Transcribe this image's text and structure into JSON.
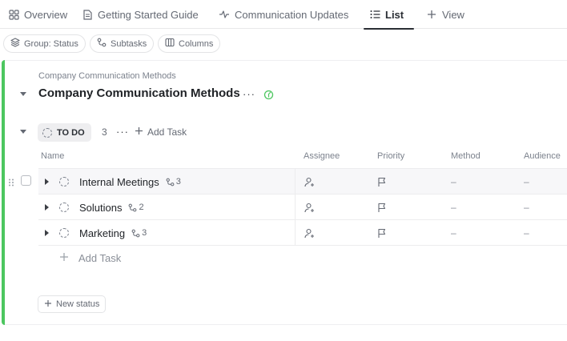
{
  "tabs": [
    {
      "label": "Overview",
      "icon": "grid-icon"
    },
    {
      "label": "Getting Started Guide",
      "icon": "document-icon"
    },
    {
      "label": "Communication Updates",
      "icon": "activity-icon"
    },
    {
      "label": "List",
      "icon": "list-icon",
      "active": true
    },
    {
      "label": "View",
      "icon": "plus-icon"
    }
  ],
  "toolbar": {
    "group_label": "Group: Status",
    "subtasks_label": "Subtasks",
    "columns_label": "Columns"
  },
  "list": {
    "breadcrumb": "Company Communication Methods",
    "title": "Company Communication Methods",
    "accent_color": "#4cc65f"
  },
  "status_group": {
    "name": "TO DO",
    "count": "3",
    "add_task_label": "Add Task"
  },
  "columns": [
    "Name",
    "Assignee",
    "Priority",
    "Method",
    "Audience"
  ],
  "tasks": [
    {
      "name": "Internal Meetings",
      "subtasks": "3",
      "method": "–",
      "audience": "–"
    },
    {
      "name": "Solutions",
      "subtasks": "2",
      "method": "–",
      "audience": "–"
    },
    {
      "name": "Marketing",
      "subtasks": "3",
      "method": "–",
      "audience": "–"
    }
  ],
  "add_task_row_label": "Add Task",
  "new_status_label": "New status"
}
